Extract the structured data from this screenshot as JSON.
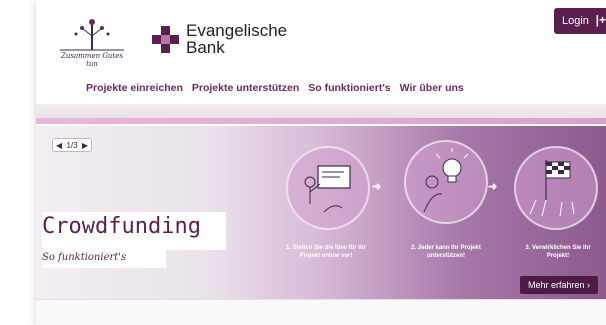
{
  "header": {
    "logo_left_text": "Zusammen Gutes tun",
    "logo_right_text": "Evangelische Bank",
    "login_label": "Login",
    "login_icon": "plus-icon"
  },
  "nav": {
    "items": [
      {
        "label": "Projekte einreichen"
      },
      {
        "label": "Projekte unterstützen"
      },
      {
        "label": "So funktioniert's"
      },
      {
        "label": "Wir über uns"
      }
    ]
  },
  "banner": {
    "slider_counter": "1/3",
    "title": "Crowdfunding",
    "subtitle": "So funktioniert's",
    "steps": [
      {
        "label": "1. Stellen Sie die Idee für Ihr Projekt online vor!"
      },
      {
        "label": "2. Jeder kann Ihr Projekt unterstützen!"
      },
      {
        "label": "3. Verwirklichen Sie Ihr Projekt!"
      }
    ],
    "more_label": "Mehr erfahren"
  },
  "colors": {
    "brand": "#5a1f4f",
    "nav": "#6a2a62",
    "accent_band": "#e2aad2"
  }
}
